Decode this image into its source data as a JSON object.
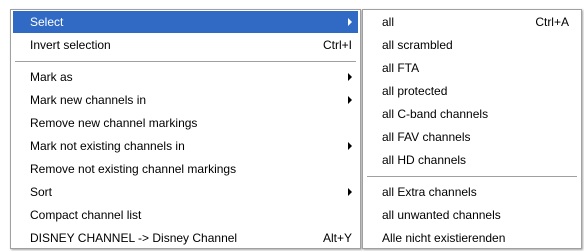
{
  "main_menu": {
    "items": [
      {
        "label": "Select",
        "shortcut": "",
        "submenu": true
      },
      {
        "label": "Invert selection",
        "shortcut": "Ctrl+I",
        "submenu": false
      },
      {
        "label": "Mark as",
        "shortcut": "",
        "submenu": true
      },
      {
        "label": "Mark new channels in",
        "shortcut": "",
        "submenu": true
      },
      {
        "label": "Remove new channel markings",
        "shortcut": "",
        "submenu": false
      },
      {
        "label": "Mark not existing channels in",
        "shortcut": "",
        "submenu": true
      },
      {
        "label": "Remove not existing channel markings",
        "shortcut": "",
        "submenu": false
      },
      {
        "label": "Sort",
        "shortcut": "",
        "submenu": true
      },
      {
        "label": "Compact channel list",
        "shortcut": "",
        "submenu": false
      },
      {
        "label": "DISNEY CHANNEL -> Disney Channel",
        "shortcut": "Alt+Y",
        "submenu": false
      }
    ]
  },
  "sub_menu": {
    "items": [
      {
        "label": "all",
        "shortcut": "Ctrl+A"
      },
      {
        "label": "all scrambled",
        "shortcut": ""
      },
      {
        "label": "all FTA",
        "shortcut": ""
      },
      {
        "label": "all protected",
        "shortcut": ""
      },
      {
        "label": "all C-band channels",
        "shortcut": ""
      },
      {
        "label": "all FAV channels",
        "shortcut": ""
      },
      {
        "label": "all HD channels",
        "shortcut": ""
      },
      {
        "label": "all Extra channels",
        "shortcut": ""
      },
      {
        "label": "all unwanted channels",
        "shortcut": ""
      },
      {
        "label": "Alle nicht existierenden",
        "shortcut": ""
      }
    ]
  },
  "colors": {
    "highlight": "#316ac5",
    "highlight_text": "#ffffff"
  }
}
